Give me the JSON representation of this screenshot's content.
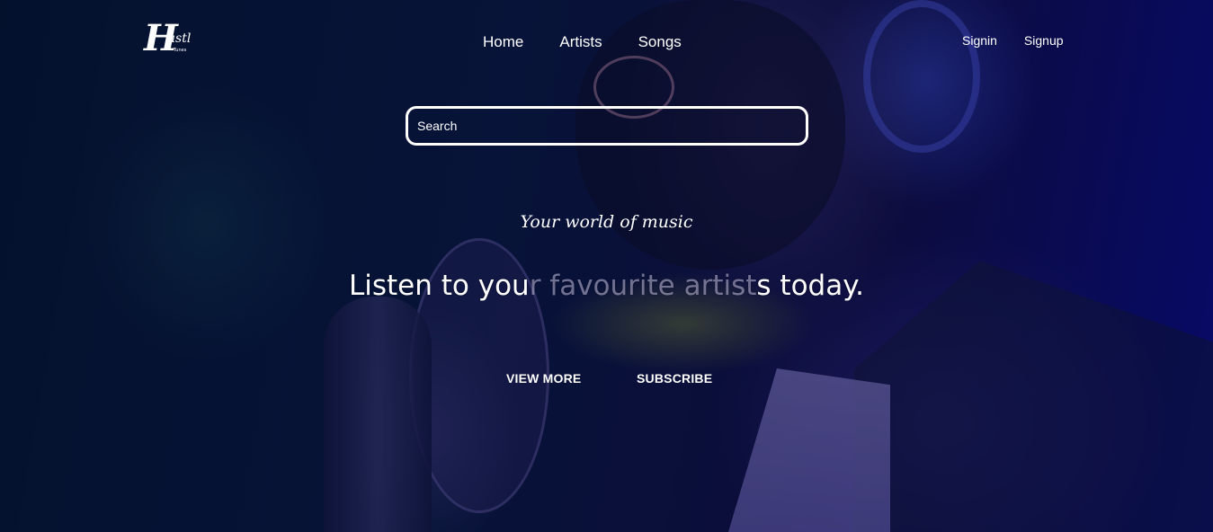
{
  "brand": {
    "logo_alt": "Hustl Tunes",
    "logo_letter": "H",
    "logo_word": "ustl",
    "logo_sub": "Tunes"
  },
  "nav": {
    "items": [
      {
        "label": "Home"
      },
      {
        "label": "Artists"
      },
      {
        "label": "Songs"
      }
    ]
  },
  "auth": {
    "signin": "Signin",
    "signup": "Signup"
  },
  "search": {
    "placeholder": "Search",
    "value": ""
  },
  "hero": {
    "tagline": "Your world of music",
    "headline_part1": "Listen to you",
    "headline_part2": "r favourite artist",
    "headline_part3": "s today.",
    "view_more": "VIEW MORE",
    "subscribe": "SUBSCRIBE"
  },
  "colors": {
    "text": "#ffffff",
    "background": "#0a1a44",
    "accent": "#0a0a8e"
  }
}
